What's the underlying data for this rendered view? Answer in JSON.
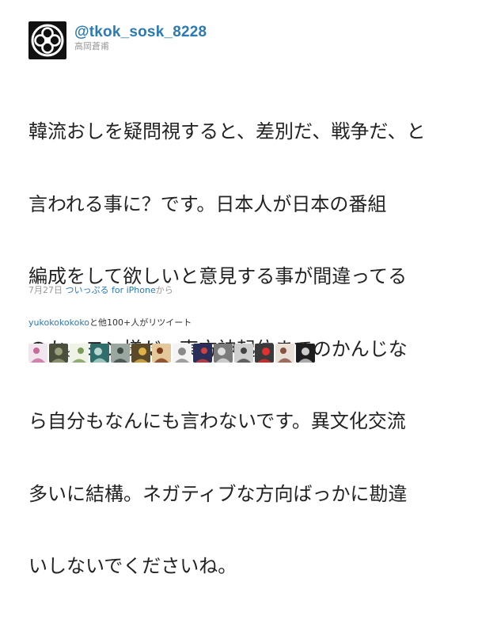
{
  "user": {
    "screen_name": "@tkok_sosk_8228",
    "full_name": "高岡蒼甫",
    "avatar_icon": "family-crest-icon"
  },
  "tweet": {
    "lines": [
      "韓流おしを疑問視すると、差別だ、戦争だ、と",
      "言われる事に？です。日本人が日本の番組",
      "編成をして欲しいと意見する事が間違ってる",
      "のか。ヨン様だ、東方神起位までのかんじな",
      "ら自分もなんにも言わないです。異文化交流",
      "多いに結構。ネガティブな方向ばっかに勘違",
      "いしないでくださいね。"
    ]
  },
  "meta": {
    "date": "7月27日",
    "client_link": "ついっぷる for iPhone",
    "suffix": "から"
  },
  "retweets": {
    "user": "yukokokokoko",
    "text": "と他100+人がリツイート",
    "avatars": [
      {
        "name": "retweeter-avatar-1",
        "bg": "#f2e6ee",
        "fg": "#c86a9a"
      },
      {
        "name": "retweeter-avatar-2",
        "bg": "#4a4f3e",
        "fg": "#9aa07a"
      },
      {
        "name": "retweeter-avatar-3",
        "bg": "#eef3e6",
        "fg": "#7a9a5a"
      },
      {
        "name": "retweeter-avatar-4",
        "bg": "#2f6e6a",
        "fg": "#b9d8d2"
      },
      {
        "name": "retweeter-avatar-5",
        "bg": "#9aa6a0",
        "fg": "#3c4a44"
      },
      {
        "name": "retweeter-avatar-6",
        "bg": "#5a4a2a",
        "fg": "#e0b24a"
      },
      {
        "name": "retweeter-avatar-7",
        "bg": "#e4c89a",
        "fg": "#7a3a1a"
      },
      {
        "name": "retweeter-avatar-8",
        "bg": "#f4f4f4",
        "fg": "#8a8a8a"
      },
      {
        "name": "retweeter-avatar-9",
        "bg": "#2a2f5a",
        "fg": "#d04040"
      },
      {
        "name": "retweeter-avatar-10",
        "bg": "#7a7a7a",
        "fg": "#dddddd"
      },
      {
        "name": "retweeter-avatar-11",
        "bg": "#cfcfcf",
        "fg": "#444444"
      },
      {
        "name": "retweeter-avatar-12",
        "bg": "#3a3a3a",
        "fg": "#e03030"
      },
      {
        "name": "retweeter-avatar-13",
        "bg": "#e9e0d8",
        "fg": "#8a5040"
      },
      {
        "name": "retweeter-avatar-14",
        "bg": "#1e1e1e",
        "fg": "#cccccc"
      }
    ]
  },
  "colors": {
    "link": "#2a7ab3",
    "text": "#222222",
    "muted": "#999999"
  }
}
